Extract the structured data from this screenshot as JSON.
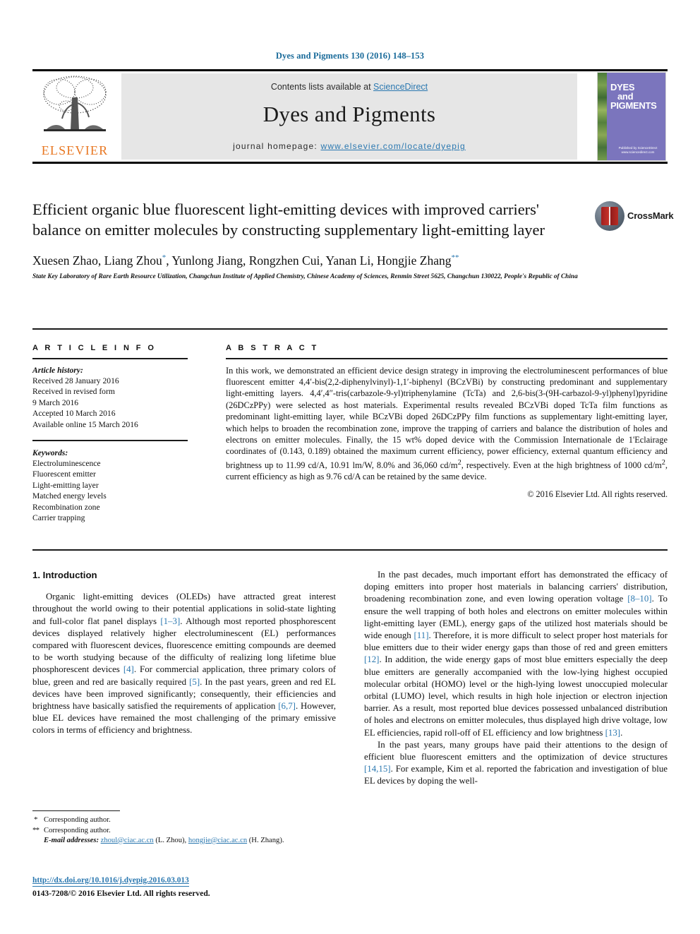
{
  "running_head": "Dyes and Pigments 130 (2016) 148–153",
  "masthead": {
    "contents_prefix": "Contents lists available at ",
    "sciencedirect": "ScienceDirect",
    "journal_title": "Dyes and Pigments",
    "homepage_prefix": "journal homepage: ",
    "homepage_url": "www.elsevier.com/locate/dyepig",
    "publisher_logo_text": "ELSEVIER",
    "publisher_logo_icon": "elsevier-tree-icon",
    "cover": {
      "line1": "DYES",
      "line2": "and",
      "line3": "PIGMENTS",
      "footer": "Published by ScienceDirect www.sciencedirect.com"
    }
  },
  "article": {
    "title": "Efficient organic blue fluorescent light-emitting devices with improved carriers' balance on emitter molecules by constructing supplementary light-emitting layer",
    "authors_plain": "Xuesen Zhao, Liang Zhou",
    "authors": [
      {
        "name": "Xuesen Zhao",
        "mark": ""
      },
      {
        "name": "Liang Zhou",
        "mark": "*"
      },
      {
        "name": "Yunlong Jiang",
        "mark": ""
      },
      {
        "name": "Rongzhen Cui",
        "mark": ""
      },
      {
        "name": "Yanan Li",
        "mark": ""
      },
      {
        "name": "Hongjie Zhang",
        "mark": "**"
      }
    ],
    "affiliation": "State Key Laboratory of Rare Earth Resource Utilization, Changchun Institute of Applied Chemistry, Chinese Academy of Sciences, Renmin Street 5625, Changchun 130022, People's Republic of China",
    "crossmark_label": "CrossMark",
    "crossmark_icon": "crossmark-icon"
  },
  "article_info": {
    "heading": "A R T I C L E   I N F O",
    "history_title": "Article history:",
    "history": [
      "Received 28 January 2016",
      "Received in revised form",
      "9 March 2016",
      "Accepted 10 March 2016",
      "Available online 15 March 2016"
    ],
    "keywords_title": "Keywords:",
    "keywords": [
      "Electroluminescence",
      "Fluorescent emitter",
      "Light-emitting layer",
      "Matched energy levels",
      "Recombination zone",
      "Carrier trapping"
    ]
  },
  "abstract": {
    "heading": "A B S T R A C T",
    "body": "In this work, we demonstrated an efficient device design strategy in improving the electroluminescent performances of blue fluorescent emitter 4,4′-bis(2,2-diphenylvinyl)-1,1′-biphenyl (BCzVBi) by constructing predominant and supplementary light-emitting layers. 4,4′,4″-tris(carbazole-9-yl)triphenylamine (TcTa) and 2,6-bis(3-(9H-carbazol-9-yl)phenyl)pyridine (26DCzPPy) were selected as host materials. Experimental results revealed BCzVBi doped TcTa film functions as predominant light-emitting layer, while BCzVBi doped 26DCzPPy film functions as supplementary light-emitting layer, which helps to broaden the recombination zone, improve the trapping of carriers and balance the distribution of holes and electrons on emitter molecules. Finally, the 15 wt% doped device with the Commission Internationale de 1'Eclairage coordinates of (0.143, 0.189) obtained the maximum current efficiency, power efficiency, external quantum efficiency and brightness up to 11.99 cd/A, 10.91 lm/W, 8.0% and 36,060 cd/m2, respectively. Even at the high brightness of 1000 cd/m2, current efficiency as high as 9.76 cd/A can be retained by the same device.",
    "copyright": "© 2016 Elsevier Ltd. All rights reserved."
  },
  "introduction": {
    "section_number_title": "1.  Introduction",
    "left_paragraphs": [
      "Organic light-emitting devices (OLEDs) have attracted great interest throughout the world owing to their potential applications in solid-state lighting and full-color flat panel displays [1–3]. Although most reported phosphorescent devices displayed relatively higher electroluminescent (EL) performances compared with fluorescent devices, fluorescence emitting compounds are deemed to be worth studying because of the difficulty of realizing long lifetime blue phosphorescent devices [4]. For commercial application, three primary colors of blue, green and red are basically required [5]. In the past years, green and red EL devices have been improved significantly; consequently, their efficiencies and brightness have basically satisfied the requirements of application [6,7]. However, blue EL devices have remained the most challenging of the primary emissive colors in terms of efficiency and brightness."
    ],
    "right_paragraphs": [
      "In the past decades, much important effort has demonstrated the efficacy of doping emitters into proper host materials in balancing carriers' distribution, broadening recombination zone, and even lowing operation voltage [8–10]. To ensure the well trapping of both holes and electrons on emitter molecules within light-emitting layer (EML), energy gaps of the utilized host materials should be wide enough [11]. Therefore, it is more difficult to select proper host materials for blue emitters due to their wider energy gaps than those of red and green emitters [12]. In addition, the wide energy gaps of most blue emitters especially the deep blue emitters are generally accompanied with the low-lying highest occupied molecular orbital (HOMO) level or the high-lying lowest unoccupied molecular orbital (LUMO) level, which results in high hole injection or electron injection barrier. As a result, most reported blue devices possessed unbalanced distribution of holes and electrons on emitter molecules, thus displayed high drive voltage, low EL efficiencies, rapid roll-off of EL efficiency and low brightness [13].",
      "In the past years, many groups have paid their attentions to the design of efficient blue fluorescent emitters and the optimization of device structures [14,15]. For example, Kim et al. reported the fabrication and investigation of blue EL devices by doping the well-"
    ]
  },
  "footnotes": {
    "corr1_mark": "*",
    "corr1": "Corresponding author.",
    "corr2_mark": "**",
    "corr2": "Corresponding author.",
    "email_label": "E-mail addresses:",
    "email1": "zhoul@ciac.ac.cn",
    "email1_who": "(L. Zhou),",
    "email2": "hongjie@ciac.ac.cn",
    "email2_who": "(H. Zhang)."
  },
  "doi": {
    "url": "http://dx.doi.org/10.1016/j.dyepig.2016.03.013",
    "issn_line": "0143-7208/© 2016 Elsevier Ltd. All rights reserved."
  },
  "colors": {
    "link_blue": "#2b78b0",
    "running_head_blue": "#1a6b9a",
    "elsevier_orange": "#E87722",
    "cover_purple": "#7b75bd",
    "band_gray": "#e6e6e6"
  }
}
